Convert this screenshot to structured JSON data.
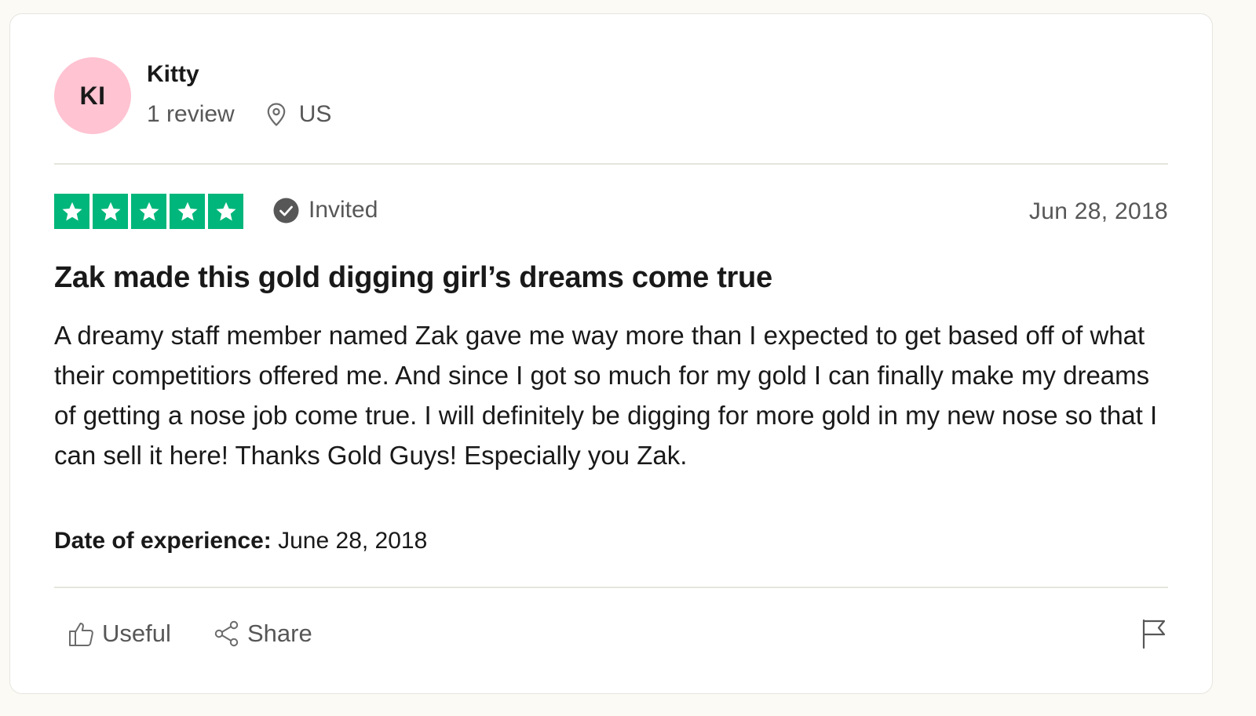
{
  "reviewer": {
    "initials": "KI",
    "name": "Kitty",
    "review_count": "1 review",
    "country": "US",
    "avatar_color": "#ffc3d2"
  },
  "review": {
    "rating": 5,
    "max_rating": 5,
    "star_color": "#00b67a",
    "badge_icon": "check-circle-icon",
    "badge_label": "Invited",
    "date": "Jun 28, 2018",
    "title": "Zak made this gold digging girl’s dreams come true",
    "body": "A dreamy staff member named Zak gave me way more than I expected to get based off of what their competitiors offered me. And since I got so much for my gold I can finally make my dreams of getting a nose job come true. I will definitely be digging for more gold in my new nose so that I can sell it here! Thanks Gold Guys! Especially you Zak.",
    "experience_label": "Date of experience:",
    "experience_date": "June 28, 2018"
  },
  "actions": {
    "useful_label": "Useful",
    "useful_icon": "thumbs-up-icon",
    "share_label": "Share",
    "share_icon": "share-icon",
    "report_icon": "flag-icon"
  }
}
